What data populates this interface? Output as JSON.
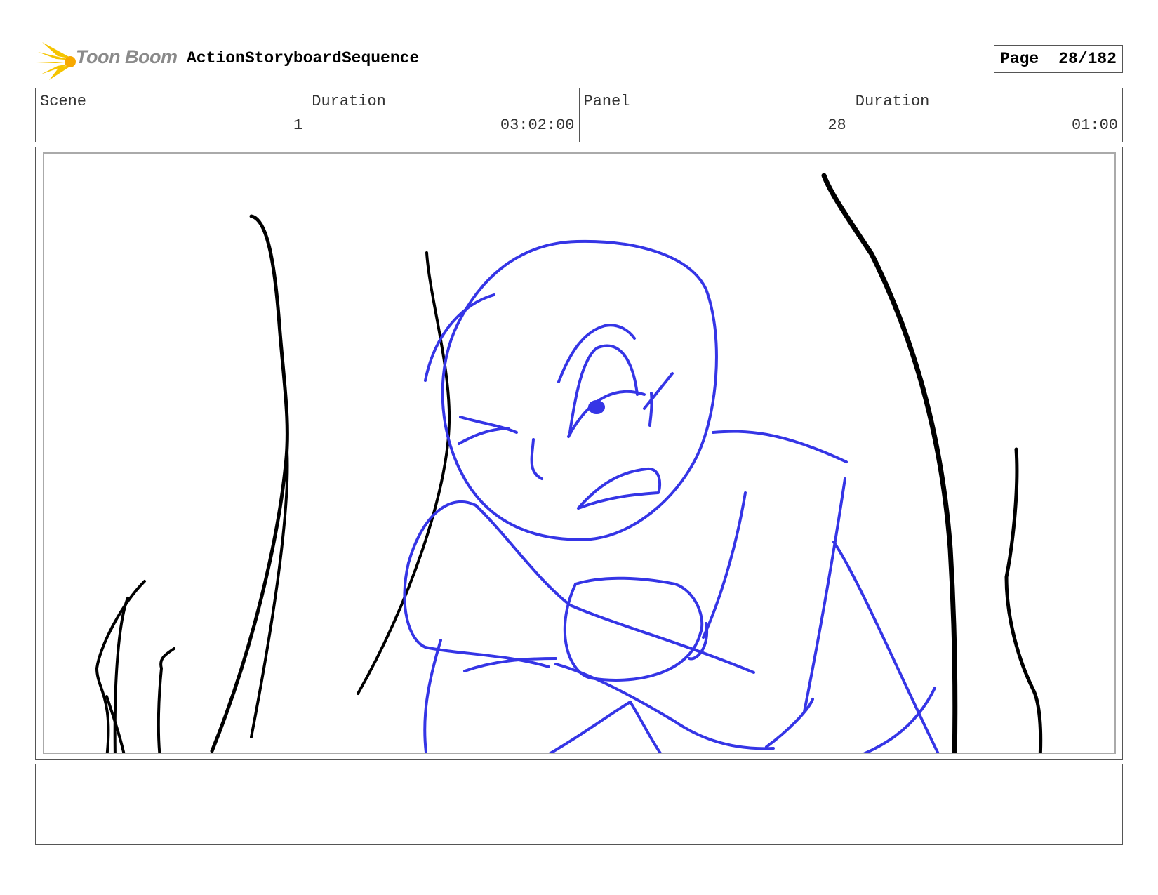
{
  "header": {
    "logo_text": "Toon Boom",
    "sequence_title": "ActionStoryboardSequence",
    "page_label": "Page",
    "page_value": "28/182"
  },
  "info": {
    "scene_label": "Scene",
    "scene_value": "1",
    "scene_duration_label": "Duration",
    "scene_duration_value": "03:02:00",
    "panel_label": "Panel",
    "panel_value": "28",
    "panel_duration_label": "Duration",
    "panel_duration_value": "01:00"
  },
  "colors": {
    "sketch_blue": "#3535e6",
    "sketch_black": "#000000",
    "logo_yellow": "#f5c400"
  },
  "notes": {
    "text": ""
  }
}
